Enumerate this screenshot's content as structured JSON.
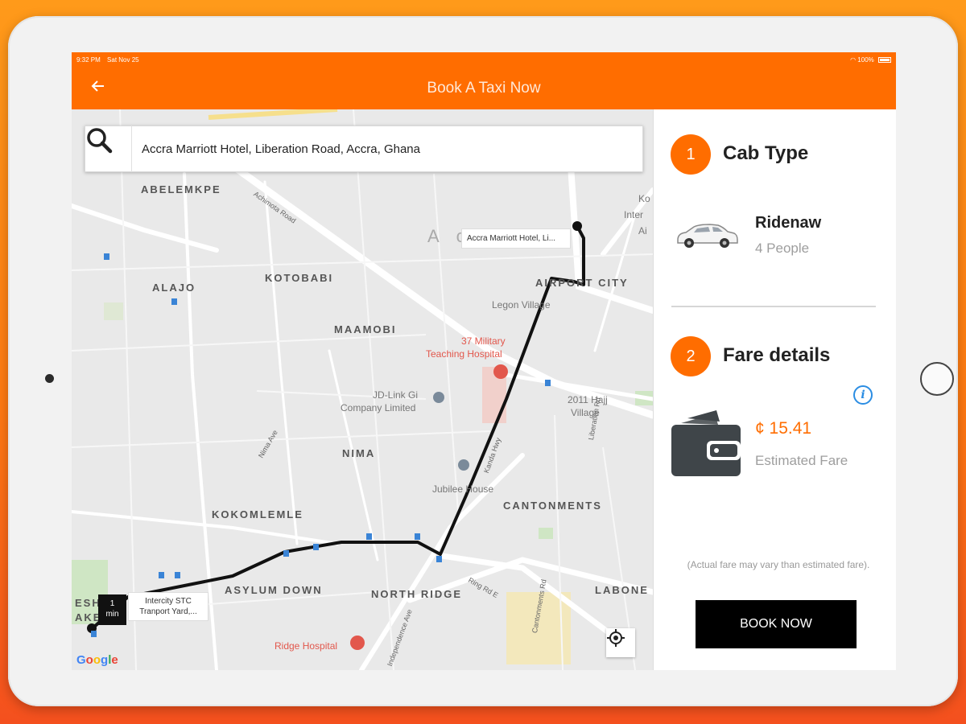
{
  "status_bar": {
    "time": "9:32 PM",
    "date": "Sat Nov 25",
    "battery": "100%"
  },
  "app_bar": {
    "title": "Book A Taxi Now",
    "back_icon": "arrow-left-icon"
  },
  "search": {
    "value": "Accra Marriott Hotel, Liberation Road, Accra, Ghana",
    "icon": "search-icon"
  },
  "map": {
    "destination_callout": "Accra Marriott Hotel, Li...",
    "origin_callout_line1": "Intercity STC",
    "origin_callout_line2": "Tranport Yard,...",
    "eta_value": "1",
    "eta_unit": "min",
    "labels": {
      "abelemkpe": "ABELEMKPE",
      "kotobabi": "KOTOBABI",
      "alajo": "ALAJO",
      "maamobi": "MAAMOBI",
      "nima": "NIMA",
      "kokomlemle": "KOKOMLEMLE",
      "asylum_down": "ASYLUM DOWN",
      "north_ridge": "NORTH RIDGE",
      "cantonments": "CANTONMENTS",
      "labone": "LABONE",
      "airport_city": "AIRPORT CITY",
      "legon_village": "Legon Village",
      "hajj_village_1": "2011 Hajj",
      "hajj_village_2": "Village",
      "jd_link_1": "JD-Link Gi",
      "jd_link_2": "Company Limited",
      "jubilee_house": "Jubilee House",
      "military_hospital_1": "37 Military",
      "military_hospital_2": "Teaching Hospital",
      "ridge_hospital": "Ridge Hospital",
      "accra_partial": "A c",
      "kotoka_1": "Ko",
      "kotoka_2": "Inter",
      "kotoka_3": "Ai",
      "eshie_1": "ESHIE",
      "eshie_2": "AKET"
    },
    "streets": {
      "achimota": "Achimota Road",
      "kanda": "Kanda Hwy",
      "ring": "Ring Rd E",
      "nima_ave": "Nima Ave",
      "independence": "Independence Ave",
      "liberation": "Liberation Rd",
      "cantonments_rd": "Cantonments Rd"
    },
    "google_logo": "Google",
    "locate_icon": "crosshair-icon"
  },
  "panel": {
    "step1_number": "1",
    "step1_title": "Cab Type",
    "cab_name": "Ridenaw",
    "cab_capacity": "4 People",
    "step2_number": "2",
    "step2_title": "Fare details",
    "fare_amount": "¢ 15.41",
    "fare_label": "Estimated Fare",
    "note": "(Actual fare may vary than estimated fare).",
    "book_button": "BOOK NOW"
  },
  "colors": {
    "accent": "#ff6d00",
    "route": "#111111",
    "info": "#2b8de3"
  }
}
